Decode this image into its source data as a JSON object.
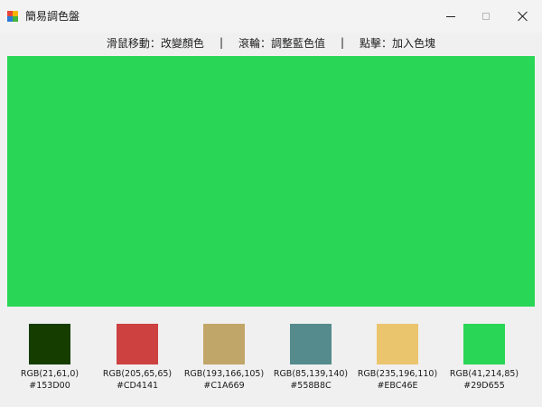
{
  "window": {
    "title": "簡易調色盤",
    "icon": "palette-app-icon",
    "controls": [
      "minimize-icon",
      "maximize-icon",
      "close-icon"
    ]
  },
  "instructions": {
    "mouse": "滑鼠移動：改變顏色",
    "separator": "|",
    "wheel": "滾輪：調整藍色值",
    "click": "點擊：加入色塊"
  },
  "display": {
    "color": "#29D655"
  },
  "swatches": [
    {
      "rgb": "RGB(21,61,0)",
      "hex": "#153D00",
      "color": "#153D00"
    },
    {
      "rgb": "RGB(205,65,65)",
      "hex": "#CD4141",
      "color": "#CD4141"
    },
    {
      "rgb": "RGB(193,166,105)",
      "hex": "#C1A669",
      "color": "#C1A669"
    },
    {
      "rgb": "RGB(85,139,140)",
      "hex": "#558B8C",
      "color": "#558B8C"
    },
    {
      "rgb": "RGB(235,196,110)",
      "hex": "#EBC46E",
      "color": "#EBC46E"
    },
    {
      "rgb": "RGB(41,214,85)",
      "hex": "#29D655",
      "color": "#29D655"
    }
  ]
}
